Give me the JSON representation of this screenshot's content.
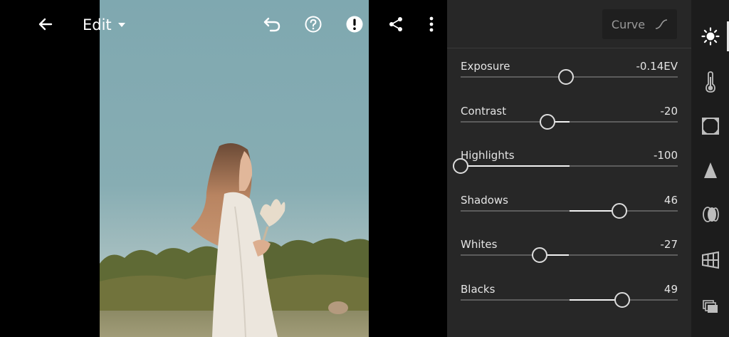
{
  "toolbar": {
    "edit_label": "Edit"
  },
  "panel": {
    "curve_label": "Curve",
    "sliders": [
      {
        "name": "Exposure",
        "value": "-0.14EV",
        "position": 0.486,
        "center": 0.5
      },
      {
        "name": "Contrast",
        "value": "-20",
        "position": 0.4,
        "center": 0.5
      },
      {
        "name": "Highlights",
        "value": "-100",
        "position": 0.0,
        "center": 0.5
      },
      {
        "name": "Shadows",
        "value": "46",
        "position": 0.73,
        "center": 0.5
      },
      {
        "name": "Whites",
        "value": "-27",
        "position": 0.365,
        "center": 0.5
      },
      {
        "name": "Blacks",
        "value": "49",
        "position": 0.745,
        "center": 0.5
      }
    ]
  },
  "rail": {
    "active": "light",
    "items": [
      "light",
      "color",
      "effects",
      "detail",
      "optics",
      "geometry",
      "versions"
    ]
  },
  "colors": {
    "panel_bg": "#272727",
    "rail_bg": "#1c1c1c",
    "accent": "#f2f2f2"
  }
}
